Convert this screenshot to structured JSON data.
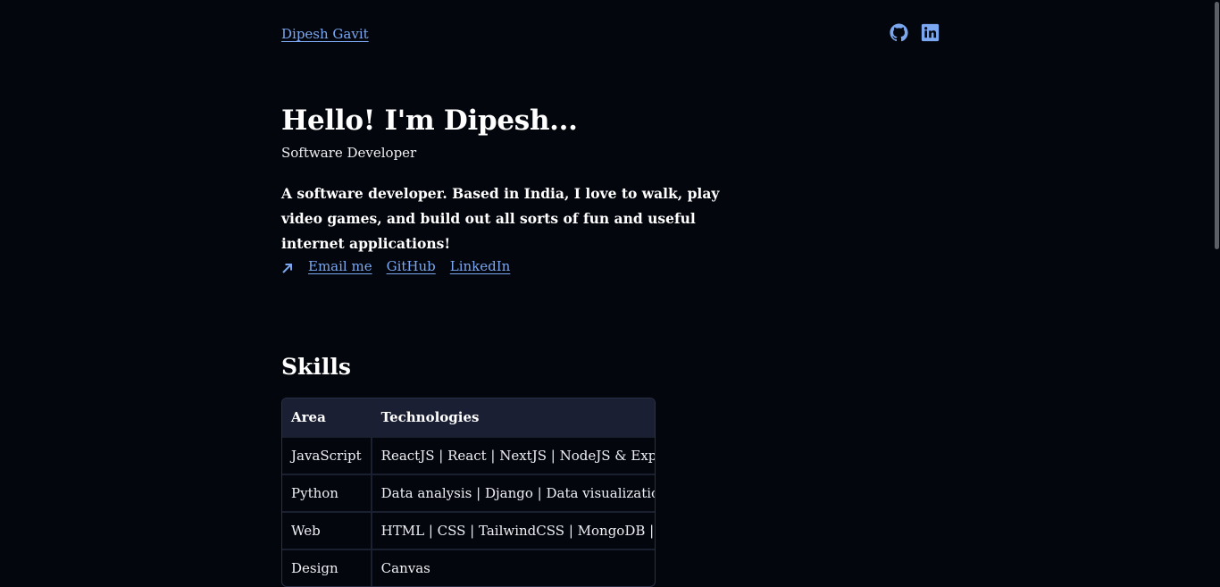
{
  "header": {
    "brand": "Dipesh Gavit",
    "social": [
      {
        "name": "github-icon"
      },
      {
        "name": "linkedin-icon"
      }
    ]
  },
  "hero": {
    "title": "Hello! I'm Dipesh...",
    "subtitle": "Software Developer",
    "description": "A software developer. Based in India, I love to walk, play video games, and build out all sorts of fun and useful internet applications!",
    "links": [
      "Email me",
      "GitHub",
      "LinkedIn"
    ]
  },
  "skills": {
    "title": "Skills",
    "columns": [
      "Area",
      "Technologies"
    ],
    "rows": [
      [
        "JavaScript",
        "ReactJS | React | NextJS | NodeJS & ExpressJS"
      ],
      [
        "Python",
        "Data analysis | Django | Data visualization"
      ],
      [
        "Web",
        "HTML | CSS | TailwindCSS | MongoDB | GIT"
      ],
      [
        "Design",
        "Canvas"
      ]
    ]
  },
  "colors": {
    "background": "#04060d",
    "accent": "#7aa7f0",
    "table_header": "#1b1f33"
  }
}
